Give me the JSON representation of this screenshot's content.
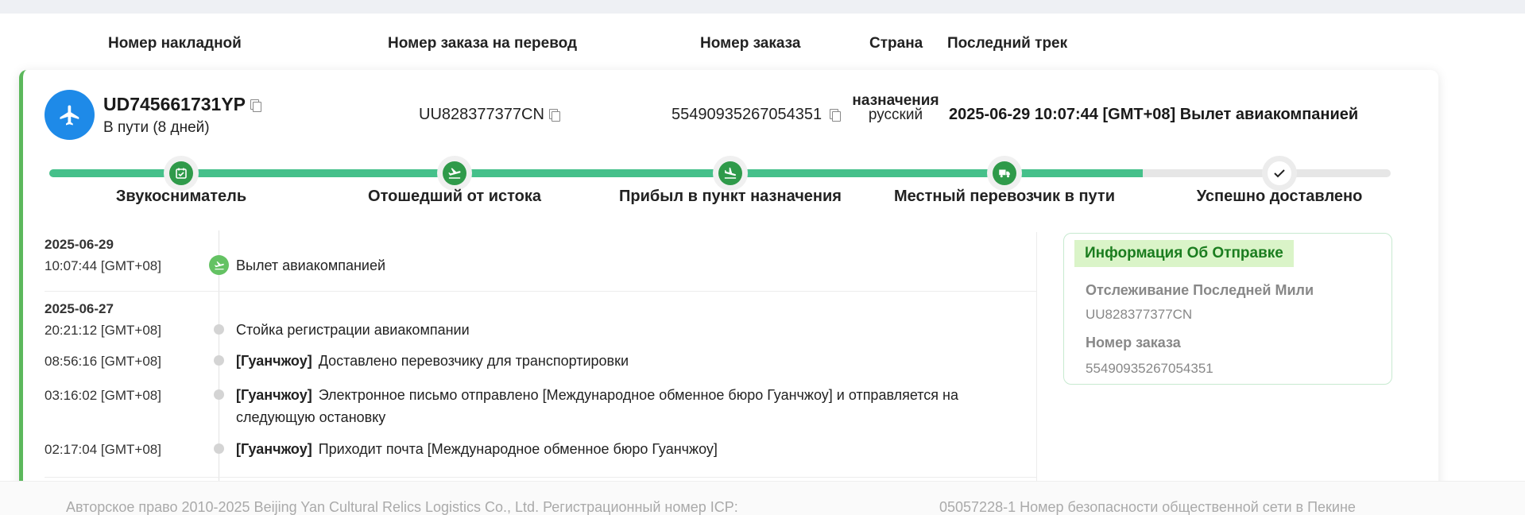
{
  "columns": {
    "waybill": "Номер накладной",
    "transfer_order": "Номер заказа на перевод",
    "order": "Номер заказа",
    "country": "Страна",
    "last_track": "Последний трек"
  },
  "shipment": {
    "waybill_number": "UD745661731YP",
    "status": "В пути (8 дней)",
    "transfer_order_number": "UU828377377CN",
    "order_number": "55490935267054351",
    "destination_label": "назначения",
    "destination_value": "русский",
    "last_track": "2025-06-29 10:07:44 [GMT+08] Вылет авиакомпанией"
  },
  "progress": {
    "completed_fraction": 0.815,
    "steps": [
      {
        "label": "Звукосниматель",
        "icon": "pickup-icon",
        "done": true
      },
      {
        "label": "Отошедший от истока",
        "icon": "departure-plane-icon",
        "done": true
      },
      {
        "label": "Прибыл в пункт назначения",
        "icon": "arrival-plane-icon",
        "done": true
      },
      {
        "label": "Местный перевозчик в пути",
        "icon": "delivery-truck-icon",
        "done": true
      },
      {
        "label": "Успешно доставлено",
        "icon": "checkmark-icon",
        "done": false
      }
    ]
  },
  "timeline": [
    {
      "date": "2025-06-29",
      "events": [
        {
          "time": "10:07:44 [GMT+08]",
          "location": "",
          "text": "Вылет авиакомпанией",
          "highlight": true
        }
      ]
    },
    {
      "date": "2025-06-27",
      "events": [
        {
          "time": "20:21:12 [GMT+08]",
          "location": "",
          "text": "Стойка регистрации авиакомпании"
        },
        {
          "time": "08:56:16 [GMT+08]",
          "location": "[Гуанчжоу]",
          "text": "Доставлено перевозчику для транспортировки"
        },
        {
          "time": "03:16:02 [GMT+08]",
          "location": "[Гуанчжоу]",
          "text": "Электронное письмо отправлено [Международное обменное бюро Гуанчжоу] и отправляется на следующую остановку"
        },
        {
          "time": "02:17:04 [GMT+08]",
          "location": "[Гуанчжоу]",
          "text": "Приходит почта [Международное обменное бюро Гуанчжоу]"
        }
      ]
    }
  ],
  "info_panel": {
    "title": "Информация Об Отправке",
    "last_mile_label": "Отслеживание Последней Мили",
    "last_mile_value": "UU828377377CN",
    "order_label": "Номер заказа",
    "order_value": "55490935267054351"
  },
  "footer": {
    "left": "Авторское право 2010-2025 Beijing Yan Cultural Relics Logistics Co., Ltd. Регистрационный номер ICP:",
    "right": "05057228-1 Номер безопасности общественной сети в Пекине"
  },
  "colors": {
    "accent_green": "#45c08a",
    "node_green": "#2f9a4a",
    "avatar_blue": "#1e8ae8",
    "card_border": "#5cb85c"
  }
}
